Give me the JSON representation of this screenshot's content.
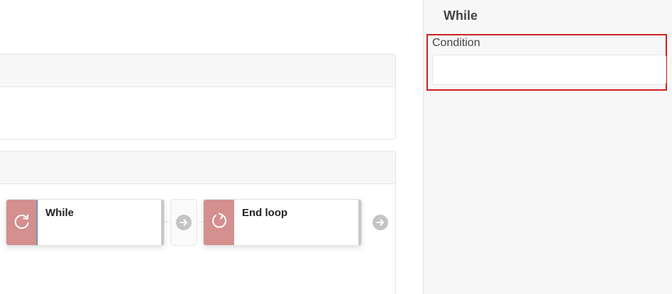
{
  "flow": {
    "steps": [
      {
        "label": "While",
        "icon": "loop-icon",
        "selected": true
      },
      {
        "label": "End loop",
        "icon": "end-loop-icon",
        "selected": false
      }
    ],
    "connector_icon": "arrow-right-icon"
  },
  "side_panel": {
    "title": "While",
    "fields": [
      {
        "label": "Condition",
        "value": "",
        "placeholder": ""
      }
    ],
    "highlight_color": "#cc2222"
  },
  "colors": {
    "step_icon_bg": "#d48f8f",
    "selected_border": "#1c8fb3",
    "arrow_gray": "#c4c4c4"
  }
}
